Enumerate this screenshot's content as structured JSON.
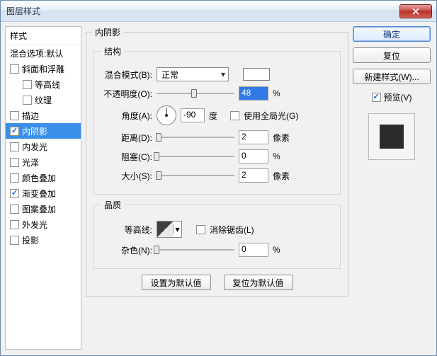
{
  "window": {
    "title": "图层样式"
  },
  "sidebar": {
    "header": "样式",
    "blend_options": "混合选项:默认",
    "items": [
      {
        "label": "斜面和浮雕",
        "checked": false
      },
      {
        "label": "等高线",
        "checked": false,
        "sub": true
      },
      {
        "label": "纹理",
        "checked": false,
        "sub": true
      },
      {
        "label": "描边",
        "checked": false
      },
      {
        "label": "内阴影",
        "checked": true,
        "selected": true
      },
      {
        "label": "内发光",
        "checked": false
      },
      {
        "label": "光泽",
        "checked": false
      },
      {
        "label": "颜色叠加",
        "checked": false
      },
      {
        "label": "渐变叠加",
        "checked": true
      },
      {
        "label": "图案叠加",
        "checked": false
      },
      {
        "label": "外发光",
        "checked": false
      },
      {
        "label": "投影",
        "checked": false
      }
    ]
  },
  "panel": {
    "title": "内阴影",
    "structure": {
      "legend": "结构",
      "blend_mode": {
        "label": "混合模式(B):",
        "value": "正常"
      },
      "opacity": {
        "label": "不透明度(O):",
        "value": "48",
        "unit": "%",
        "pos": 48
      },
      "angle": {
        "label": "角度(A):",
        "value": "-90",
        "unit": "度"
      },
      "use_global": {
        "label": "使用全局光(G)",
        "checked": false
      },
      "distance": {
        "label": "距离(D):",
        "value": "2",
        "unit": "像素",
        "pos": 3
      },
      "choke": {
        "label": "阻塞(C):",
        "value": "0",
        "unit": "%",
        "pos": 0
      },
      "size": {
        "label": "大小(S):",
        "value": "2",
        "unit": "像素",
        "pos": 3
      }
    },
    "quality": {
      "legend": "品质",
      "contour": {
        "label": "等高线:"
      },
      "antialias": {
        "label": "消除锯齿(L)",
        "checked": false
      },
      "noise": {
        "label": "杂色(N):",
        "value": "0",
        "unit": "%",
        "pos": 0
      }
    },
    "buttons": {
      "make_default": "设置为默认值",
      "reset_default": "复位为默认值"
    }
  },
  "right": {
    "ok": "确定",
    "cancel": "复位",
    "new_style": "新建样式(W)...",
    "preview": {
      "label": "预览(V)",
      "checked": true
    }
  }
}
